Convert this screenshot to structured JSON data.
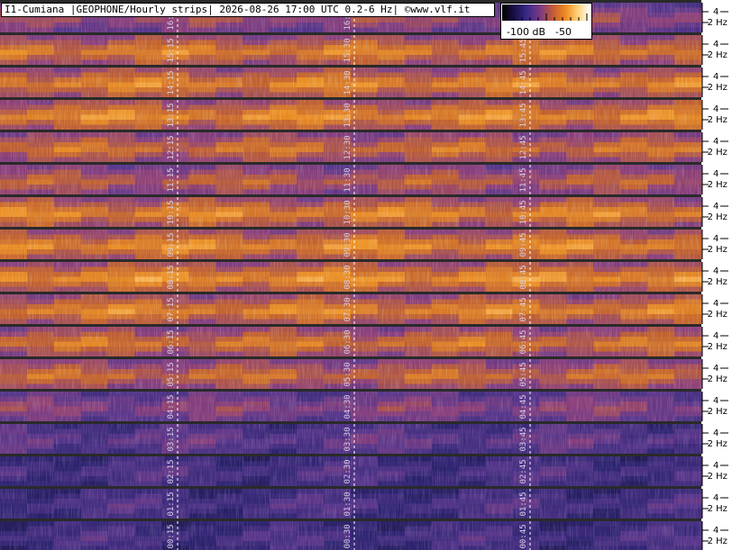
{
  "title": "I1-Cumiana |GEOPHONE/Hourly strips| 2026-08-26 17:00 UTC 0.2-6 Hz| ©www.vlf.it",
  "colorbar": {
    "labels": [
      "-100 dB",
      "-50"
    ],
    "colors": [
      "#000000",
      "#1a1048",
      "#3b2a8a",
      "#7a3a82",
      "#c25a3a",
      "#f08a1e",
      "#ffd27a",
      "#ffffff"
    ]
  },
  "chart_data": {
    "type": "heatmap",
    "title": "I1-Cumiana |GEOPHONE/Hourly strips| 2026-08-26 17:00 UTC 0.2-6 Hz| ©www.vlf.it",
    "yaxis_ticks": [
      "4",
      "2 Hz"
    ],
    "frequency_range_hz": [
      0.2,
      6
    ],
    "strips": [
      {
        "labels": [
          "16:15",
          "16:30",
          "16:45"
        ],
        "intensity": 0.55
      },
      {
        "labels": [
          "15:15",
          "15:30",
          "15:45"
        ],
        "intensity": 0.78
      },
      {
        "labels": [
          "14:15",
          "14:30",
          "14:45"
        ],
        "intensity": 0.8
      },
      {
        "labels": [
          "13:15",
          "13:30",
          "13:45"
        ],
        "intensity": 0.82
      },
      {
        "labels": [
          "12:15",
          "12:30",
          "12:45"
        ],
        "intensity": 0.72
      },
      {
        "labels": [
          "11:15",
          "11:30",
          "11:45"
        ],
        "intensity": 0.65
      },
      {
        "labels": [
          "10:15",
          "10:30",
          "10:45"
        ],
        "intensity": 0.8
      },
      {
        "labels": [
          "09:15",
          "09:30",
          "09:45"
        ],
        "intensity": 0.82
      },
      {
        "labels": [
          "08:15",
          "08:30",
          "08:45"
        ],
        "intensity": 0.84
      },
      {
        "labels": [
          "07:15",
          "07:30",
          "07:45"
        ],
        "intensity": 0.8
      },
      {
        "labels": [
          "06:15",
          "06:30",
          "06:45"
        ],
        "intensity": 0.74
      },
      {
        "labels": [
          "05:15",
          "05:30",
          "05:45"
        ],
        "intensity": 0.7
      },
      {
        "labels": [
          "04:15",
          "04:30",
          "04:45"
        ],
        "intensity": 0.5
      },
      {
        "labels": [
          "03:15",
          "03:30",
          "03:45"
        ],
        "intensity": 0.38
      },
      {
        "labels": [
          "02:15",
          "02:30",
          "02:45"
        ],
        "intensity": 0.3
      },
      {
        "labels": [
          "01:15",
          "01:30",
          "01:45"
        ],
        "intensity": 0.3
      },
      {
        "labels": [
          "00:15",
          "00:30",
          "00:45"
        ],
        "intensity": 0.28
      }
    ]
  }
}
